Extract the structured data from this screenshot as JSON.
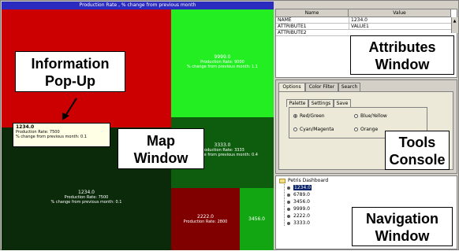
{
  "map": {
    "title": "Production Rate , % change from previous month",
    "tiles": {
      "red": {
        "value": "",
        "line1": "",
        "line2": ""
      },
      "lime": {
        "value": "9999.0",
        "line1": "Production Rate: 9000",
        "line2": "% change from previous month: 1.1"
      },
      "dark": {
        "value": "1234.0",
        "line1": "Production Rate: 7500",
        "line2": "% change from previous month: 0.1"
      },
      "mid": {
        "value": "3333.0",
        "line1": "Production Rate: 3333",
        "line2": "% change from previous month: 0.4"
      },
      "maroon": {
        "value": "2222.0",
        "line1": "Production Rate: 2800",
        "line2": ""
      },
      "green": {
        "value": "3456.0",
        "line1": "",
        "line2": ""
      }
    },
    "popup": {
      "value": "1234.0",
      "line1": "Production Rate: 7500",
      "line2": "% change from previous month: 0.1"
    }
  },
  "callouts": {
    "info_line1": "Information",
    "info_line2": "Pop-Up",
    "map_line1": "Map",
    "map_line2": "Window",
    "attr_line1": "Attributes",
    "attr_line2": "Window",
    "tools_line1": "Tools",
    "tools_line2": "Console",
    "nav_line1": "Navigation",
    "nav_line2": "Window"
  },
  "attributes": {
    "headers": [
      "Name",
      "Value"
    ],
    "rows": [
      [
        "NAME",
        "1234.0"
      ],
      [
        "ATTRIBUTE1",
        "VALUE1"
      ],
      [
        "ATTRIBUTE2",
        ""
      ]
    ]
  },
  "tools": {
    "tabs": [
      "Options",
      "Color Filter",
      "Search"
    ],
    "subtabs": [
      "Palette",
      "Settings",
      "Save"
    ],
    "radios": [
      {
        "label": "Red/Green",
        "selected": true
      },
      {
        "label": "Blue/Yellow",
        "selected": false
      },
      {
        "label": "Cyan/Magenta",
        "selected": false
      },
      {
        "label": "Orange",
        "selected": false
      }
    ]
  },
  "navigation": {
    "root": "Petris Dashboard",
    "items": [
      "1234.0",
      "6789.0",
      "3456.0",
      "9999.0",
      "2222.0",
      "3333.0"
    ],
    "selected_index": 0
  },
  "colors": {
    "red_tile": "#cc0000",
    "lime_tile": "#22ee22",
    "dark_tile": "#0a2a0a",
    "mid_tile": "#0e5c0e",
    "maroon_tile": "#800000",
    "green_tile": "#12a612",
    "title_bar": "#2b2bbf"
  }
}
